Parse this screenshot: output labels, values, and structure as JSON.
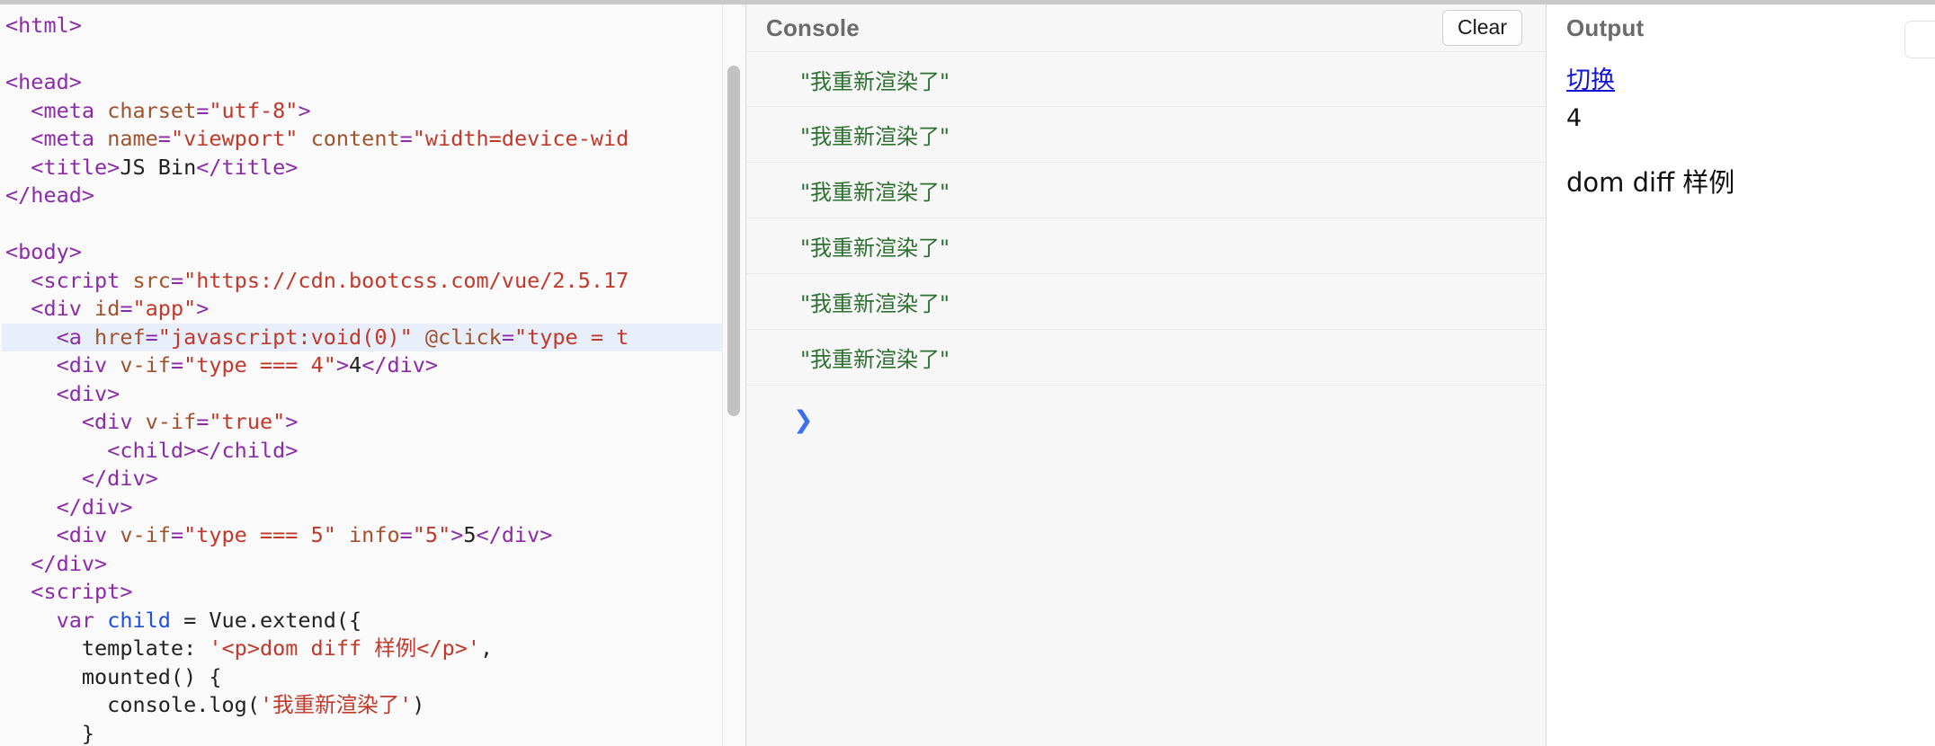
{
  "editor": {
    "name": "html-code-editor",
    "active_line_index": 11,
    "lines": [
      [
        {
          "t": "tag",
          "v": "<html>"
        }
      ],
      [
        {
          "t": "plain",
          "v": ""
        }
      ],
      [
        {
          "t": "tag",
          "v": "<head>"
        }
      ],
      [
        {
          "t": "plain",
          "v": "  "
        },
        {
          "t": "tag",
          "v": "<meta "
        },
        {
          "t": "attr",
          "v": "charset"
        },
        {
          "t": "tag",
          "v": "="
        },
        {
          "t": "str",
          "v": "\"utf-8\""
        },
        {
          "t": "tag",
          "v": ">"
        }
      ],
      [
        {
          "t": "plain",
          "v": "  "
        },
        {
          "t": "tag",
          "v": "<meta "
        },
        {
          "t": "attr",
          "v": "name"
        },
        {
          "t": "tag",
          "v": "="
        },
        {
          "t": "str",
          "v": "\"viewport\""
        },
        {
          "t": "plain",
          "v": " "
        },
        {
          "t": "attr",
          "v": "content"
        },
        {
          "t": "tag",
          "v": "="
        },
        {
          "t": "str",
          "v": "\"width=device-wid"
        }
      ],
      [
        {
          "t": "plain",
          "v": "  "
        },
        {
          "t": "tag",
          "v": "<title>"
        },
        {
          "t": "text",
          "v": "JS Bin"
        },
        {
          "t": "tag",
          "v": "</title>"
        }
      ],
      [
        {
          "t": "tag",
          "v": "</head>"
        }
      ],
      [
        {
          "t": "plain",
          "v": ""
        }
      ],
      [
        {
          "t": "tag",
          "v": "<body>"
        }
      ],
      [
        {
          "t": "plain",
          "v": "  "
        },
        {
          "t": "tag",
          "v": "<script "
        },
        {
          "t": "attr",
          "v": "src"
        },
        {
          "t": "tag",
          "v": "="
        },
        {
          "t": "str",
          "v": "\"https://cdn.bootcss.com/vue/2.5.17"
        }
      ],
      [
        {
          "t": "plain",
          "v": "  "
        },
        {
          "t": "tag",
          "v": "<div "
        },
        {
          "t": "attr",
          "v": "id"
        },
        {
          "t": "tag",
          "v": "="
        },
        {
          "t": "str",
          "v": "\"app\""
        },
        {
          "t": "tag",
          "v": ">"
        }
      ],
      [
        {
          "t": "plain",
          "v": "    "
        },
        {
          "t": "tag",
          "v": "<a "
        },
        {
          "t": "attr",
          "v": "href"
        },
        {
          "t": "tag",
          "v": "="
        },
        {
          "t": "str",
          "v": "\"javascript:void(0)\""
        },
        {
          "t": "plain",
          "v": " "
        },
        {
          "t": "attr",
          "v": "@click"
        },
        {
          "t": "tag",
          "v": "="
        },
        {
          "t": "str",
          "v": "\"type = t"
        }
      ],
      [
        {
          "t": "plain",
          "v": "    "
        },
        {
          "t": "tag",
          "v": "<div "
        },
        {
          "t": "attr",
          "v": "v-if"
        },
        {
          "t": "tag",
          "v": "="
        },
        {
          "t": "str",
          "v": "\"type === 4\""
        },
        {
          "t": "tag",
          "v": ">"
        },
        {
          "t": "text",
          "v": "4"
        },
        {
          "t": "tag",
          "v": "</div>"
        }
      ],
      [
        {
          "t": "plain",
          "v": "    "
        },
        {
          "t": "tag",
          "v": "<div>"
        }
      ],
      [
        {
          "t": "plain",
          "v": "      "
        },
        {
          "t": "tag",
          "v": "<div "
        },
        {
          "t": "attr",
          "v": "v-if"
        },
        {
          "t": "tag",
          "v": "="
        },
        {
          "t": "str",
          "v": "\"true\""
        },
        {
          "t": "tag",
          "v": ">"
        }
      ],
      [
        {
          "t": "plain",
          "v": "        "
        },
        {
          "t": "tag",
          "v": "<child></child>"
        }
      ],
      [
        {
          "t": "plain",
          "v": "      "
        },
        {
          "t": "tag",
          "v": "</div>"
        }
      ],
      [
        {
          "t": "plain",
          "v": "    "
        },
        {
          "t": "tag",
          "v": "</div>"
        }
      ],
      [
        {
          "t": "plain",
          "v": "    "
        },
        {
          "t": "tag",
          "v": "<div "
        },
        {
          "t": "attr",
          "v": "v-if"
        },
        {
          "t": "tag",
          "v": "="
        },
        {
          "t": "str",
          "v": "\"type === 5\""
        },
        {
          "t": "plain",
          "v": " "
        },
        {
          "t": "attr",
          "v": "info"
        },
        {
          "t": "tag",
          "v": "="
        },
        {
          "t": "str",
          "v": "\"5\""
        },
        {
          "t": "tag",
          "v": ">"
        },
        {
          "t": "text",
          "v": "5"
        },
        {
          "t": "tag",
          "v": "</div>"
        }
      ],
      [
        {
          "t": "plain",
          "v": "  "
        },
        {
          "t": "tag",
          "v": "</div>"
        }
      ],
      [
        {
          "t": "plain",
          "v": "  "
        },
        {
          "t": "tag",
          "v": "<script>"
        }
      ],
      [
        {
          "t": "plain",
          "v": "    "
        },
        {
          "t": "kw",
          "v": "var"
        },
        {
          "t": "plain",
          "v": " "
        },
        {
          "t": "def",
          "v": "child"
        },
        {
          "t": "plain",
          "v": " = Vue.extend({"
        }
      ],
      [
        {
          "t": "plain",
          "v": "      template: "
        },
        {
          "t": "str",
          "v": "'<p>dom diff 样例</p>'"
        },
        {
          "t": "plain",
          "v": ","
        }
      ],
      [
        {
          "t": "plain",
          "v": "      mounted() {"
        }
      ],
      [
        {
          "t": "plain",
          "v": "        console.log("
        },
        {
          "t": "str",
          "v": "'我重新渲染了'"
        },
        {
          "t": "plain",
          "v": ")"
        }
      ],
      [
        {
          "t": "plain",
          "v": "      }"
        }
      ]
    ]
  },
  "console": {
    "title": "Console",
    "clear_label": "Clear",
    "prompt_symbol": "❯",
    "input_value": "",
    "logs": [
      "\"我重新渲染了\"",
      "\"我重新渲染了\"",
      "\"我重新渲染了\"",
      "\"我重新渲染了\"",
      "\"我重新渲染了\"",
      "\"我重新渲染了\""
    ]
  },
  "output": {
    "title": "Output",
    "link_label": "切换",
    "value_line": "4",
    "paragraph": "dom diff 样例"
  },
  "colors": {
    "log_green": "#2e7031",
    "link_blue": "#1414d6",
    "prompt_blue": "#3b6ef0",
    "active_line": "#e8effb",
    "tag_purple": "#8b2ba8",
    "string_red": "#c0392b",
    "attr_brown": "#a0522d",
    "keyword_blue": "#1f4fe0"
  }
}
